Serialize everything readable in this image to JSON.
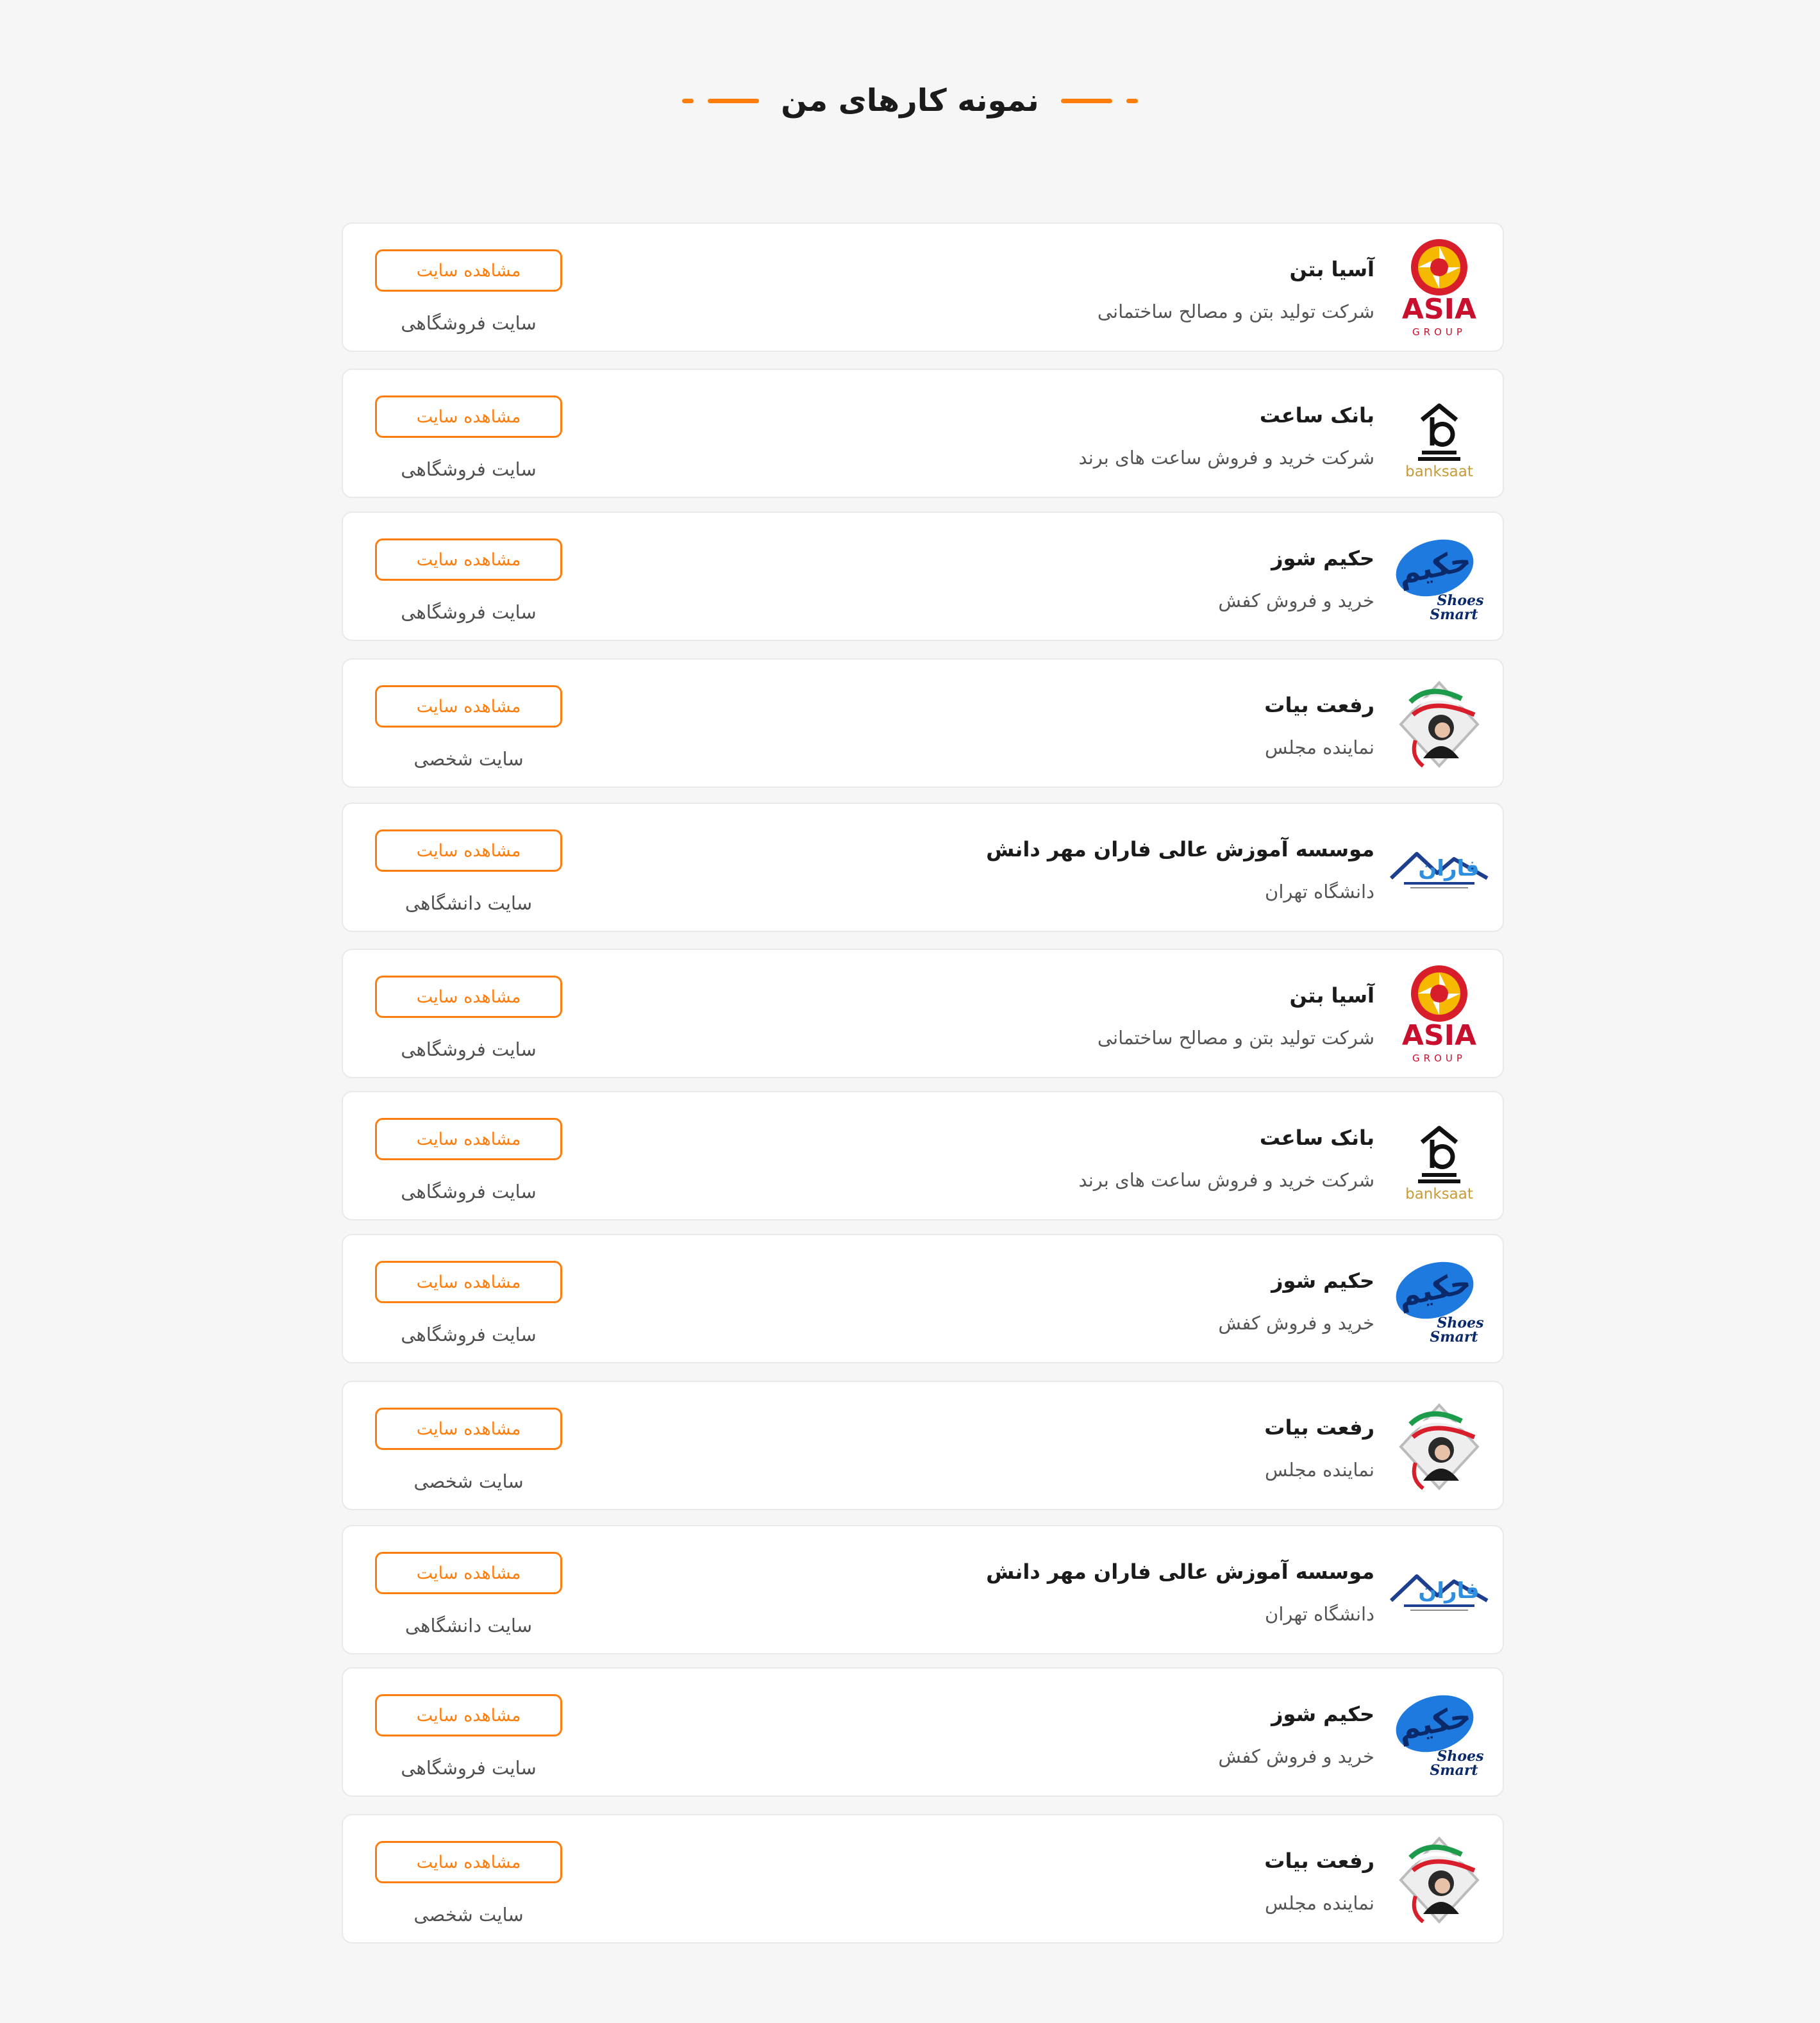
{
  "section": {
    "title": "نمونه کارهای من"
  },
  "colors": {
    "accent": "#ff7d0d",
    "background": "#f6f6f6",
    "card": "#ffffff"
  },
  "button_label": "مشاهده سایت",
  "projects": [
    {
      "name": "آسیا بتن",
      "description": "شرکت تولید بتن و مصالح ساختمانی",
      "type": "سایت فروشگاهی",
      "logo": "asia-group-logo",
      "logo_text": "ASIA",
      "logo_subtext": "GROUP"
    },
    {
      "name": "بانک ساعت",
      "description": "شرکت خرید و فروش ساعت های برند",
      "type": "سایت فروشگاهی",
      "logo": "banksaat-logo",
      "logo_text": "banksaat"
    },
    {
      "name": "حکیم شوز",
      "description": "خرید و فروش کفش",
      "type": "سایت فروشگاهی",
      "logo": "hakim-shoes-logo",
      "logo_text": "حکیم",
      "logo_subtext": "Shoes Smart"
    },
    {
      "name": "رفعت بیات",
      "description": "نماینده مجلس",
      "type": "سایت شخصی",
      "logo": "portrait-logo"
    },
    {
      "name": "موسسه آموزش عالی فاران مهر دانش",
      "description": "دانشگاه تهران",
      "type": "سایت دانشگاهی",
      "logo": "faran-logo",
      "logo_text": "فاران"
    },
    {
      "name": "آسیا بتن",
      "description": "شرکت تولید بتن و مصالح ساختمانی",
      "type": "سایت فروشگاهی",
      "logo": "asia-group-logo",
      "logo_text": "ASIA",
      "logo_subtext": "GROUP"
    },
    {
      "name": "بانک ساعت",
      "description": "شرکت خرید و فروش ساعت های برند",
      "type": "سایت فروشگاهی",
      "logo": "banksaat-logo",
      "logo_text": "banksaat"
    },
    {
      "name": "حکیم شوز",
      "description": "خرید و فروش کفش",
      "type": "سایت فروشگاهی",
      "logo": "hakim-shoes-logo",
      "logo_text": "حکیم",
      "logo_subtext": "Shoes Smart"
    },
    {
      "name": "رفعت بیات",
      "description": "نماینده مجلس",
      "type": "سایت شخصی",
      "logo": "portrait-logo"
    },
    {
      "name": "موسسه آموزش عالی فاران مهر دانش",
      "description": "دانشگاه تهران",
      "type": "سایت دانشگاهی",
      "logo": "faran-logo",
      "logo_text": "فاران"
    },
    {
      "name": "حکیم شوز",
      "description": "خرید و فروش کفش",
      "type": "سایت فروشگاهی",
      "logo": "hakim-shoes-logo",
      "logo_text": "حکیم",
      "logo_subtext": "Shoes Smart"
    },
    {
      "name": "رفعت بیات",
      "description": "نماینده مجلس",
      "type": "سایت شخصی",
      "logo": "portrait-logo"
    }
  ]
}
